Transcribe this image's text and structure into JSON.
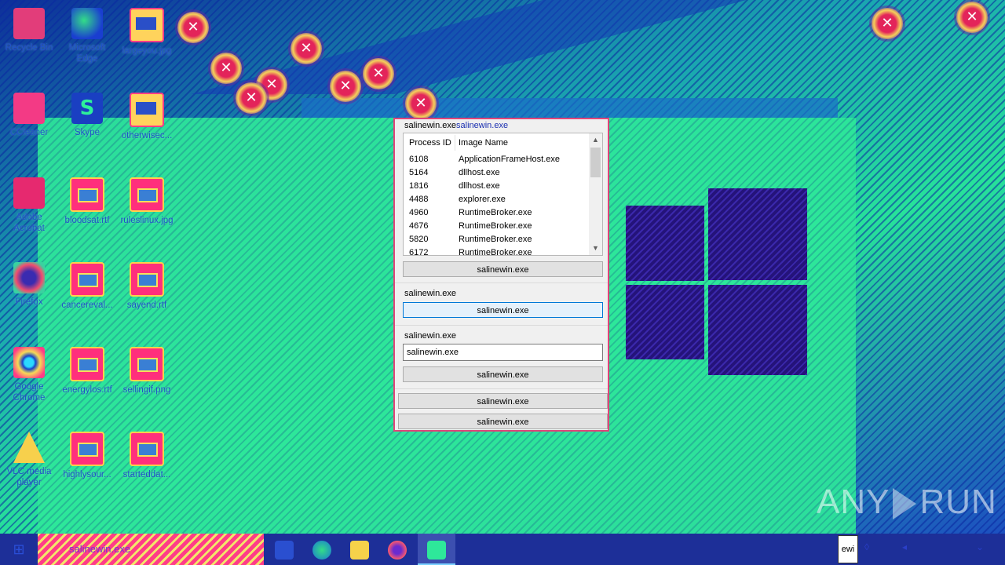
{
  "desktop": {
    "icons": [
      {
        "label": "Recycle Bin"
      },
      {
        "label": "Microsoft Edge"
      },
      {
        "label": "largeyou.jpg"
      },
      {
        "label": "CCleaner"
      },
      {
        "label": "Skype"
      },
      {
        "label": "otherwisec..."
      },
      {
        "label": "Adobe Acrobat"
      },
      {
        "label": "bloodsat.rtf"
      },
      {
        "label": "ruleslinux.jpg"
      },
      {
        "label": "Firefox"
      },
      {
        "label": "cancereval..."
      },
      {
        "label": "sayend.rtf"
      },
      {
        "label": "Google Chrome"
      },
      {
        "label": "energylos.rtf"
      },
      {
        "label": "sellingif.png"
      },
      {
        "label": "VLC media player"
      },
      {
        "label": "highlysour..."
      },
      {
        "label": "starteddat..."
      }
    ]
  },
  "dialog": {
    "title_a": "salinewin.exe",
    "title_b": "salinewin.exe",
    "columns": [
      "Process ID",
      "Image Name"
    ],
    "rows": [
      {
        "pid": "6108",
        "name": "ApplicationFrameHost.exe"
      },
      {
        "pid": "5164",
        "name": "dllhost.exe"
      },
      {
        "pid": "1816",
        "name": "dllhost.exe"
      },
      {
        "pid": "4488",
        "name": "explorer.exe"
      },
      {
        "pid": "4960",
        "name": "RuntimeBroker.exe"
      },
      {
        "pid": "4676",
        "name": "RuntimeBroker.exe"
      },
      {
        "pid": "5820",
        "name": "RuntimeBroker.exe"
      },
      {
        "pid": "6172",
        "name": "RuntimeBroker.exe"
      }
    ],
    "button1": "salinewin.exe",
    "group2_label": "salinewin.exe",
    "button2": "salinewin.exe",
    "group3_label": "salinewin.exe",
    "input_value": "salinewin.exe",
    "button3": "salinewin.exe",
    "button4": "salinewin.exe",
    "button5": "salinewin.exe"
  },
  "taskbar": {
    "search_text": "salinewin.exe",
    "tray_box": "ewi"
  },
  "watermark": {
    "left": "ANY",
    "right": "RUN"
  },
  "icons": [
    "recycle-bin-icon",
    "edge-icon",
    "image-file-icon",
    "ccleaner-icon",
    "skype-icon",
    "file-icon",
    "acrobat-icon",
    "rtf-file-icon",
    "firefox-icon",
    "chrome-icon",
    "vlc-icon",
    "windows-start-icon",
    "task-view-icon",
    "file-explorer-icon"
  ]
}
